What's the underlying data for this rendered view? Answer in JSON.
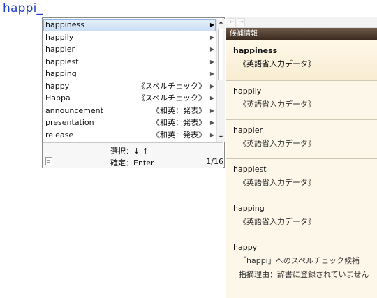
{
  "typed_text": "happi_",
  "candidates": [
    {
      "word": "happiness",
      "tag": ""
    },
    {
      "word": "happily",
      "tag": ""
    },
    {
      "word": "happier",
      "tag": ""
    },
    {
      "word": "happiest",
      "tag": ""
    },
    {
      "word": "happing",
      "tag": ""
    },
    {
      "word": "happy",
      "tag": "《スペルチェック》"
    },
    {
      "word": "Happa",
      "tag": "《スペルチェック》"
    },
    {
      "word": "announcement",
      "tag": "《和英：発表》"
    },
    {
      "word": "presentation",
      "tag": "《和英：発表》"
    },
    {
      "word": "release",
      "tag": "《和英：発表》"
    }
  ],
  "footer": {
    "select_hint": "選択：↓ ↑",
    "confirm_hint": "確定：Enter",
    "pager": "1/16"
  },
  "info_panel": {
    "nav_back": "←",
    "nav_forward": "→",
    "title": "候補情報",
    "entries": [
      {
        "word": "happiness",
        "desc": "《英語省入力データ》"
      },
      {
        "word": "happily",
        "desc": "《英語省入力データ》"
      },
      {
        "word": "happier",
        "desc": "《英語省入力データ》"
      },
      {
        "word": "happiest",
        "desc": "《英語省入力データ》"
      },
      {
        "word": "happing",
        "desc": "《英語省入力データ》"
      },
      {
        "word": "happy",
        "desc": "「happi」へのスペルチェック候補",
        "desc2": "指摘理由：辞書に登録されていません"
      }
    ]
  },
  "icons": {
    "row_arrow": "▶",
    "scroll_up": "⏶",
    "scroll_down": "⏷"
  }
}
